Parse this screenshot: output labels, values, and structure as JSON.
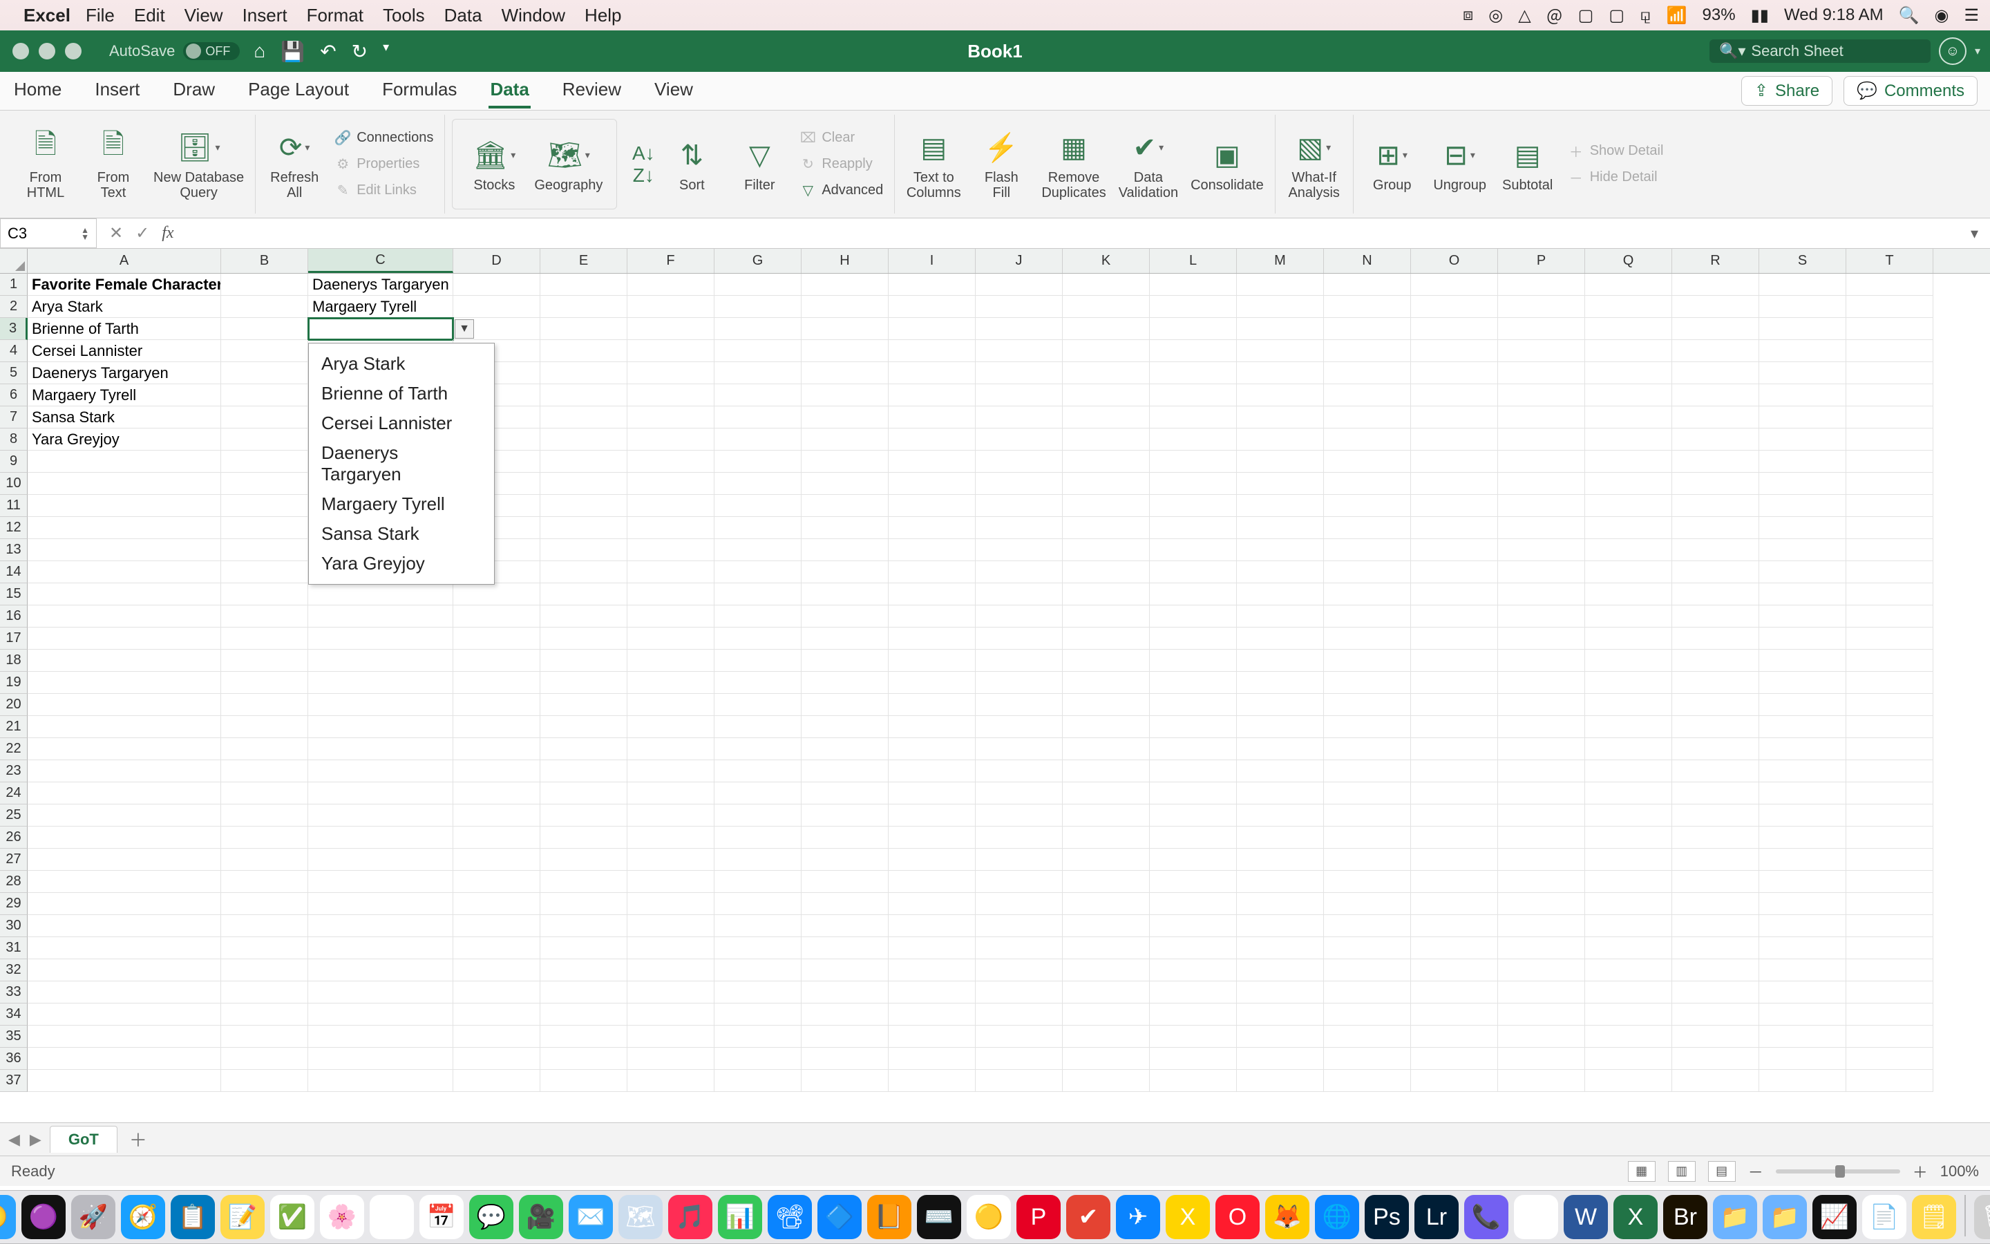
{
  "mac_menu": {
    "app_name": "Excel",
    "items": [
      "File",
      "Edit",
      "View",
      "Insert",
      "Format",
      "Tools",
      "Data",
      "Window",
      "Help"
    ],
    "battery_pct": "93%",
    "clock": "Wed 9:18 AM"
  },
  "titlebar": {
    "autosave_label": "AutoSave",
    "autosave_state": "OFF",
    "document_title": "Book1",
    "search_placeholder": "Search Sheet"
  },
  "ribbon_tabs": [
    "Home",
    "Insert",
    "Draw",
    "Page Layout",
    "Formulas",
    "Data",
    "Review",
    "View"
  ],
  "ribbon_active_tab": "Data",
  "ribbon_right": {
    "share": "Share",
    "comments": "Comments"
  },
  "ribbon": {
    "from_html": "From\nHTML",
    "from_text": "From\nText",
    "new_db_query": "New Database\nQuery",
    "refresh_all": "Refresh\nAll",
    "connections": "Connections",
    "properties": "Properties",
    "edit_links": "Edit Links",
    "stocks": "Stocks",
    "geography": "Geography",
    "sort": "Sort",
    "filter": "Filter",
    "clear": "Clear",
    "reapply": "Reapply",
    "advanced": "Advanced",
    "text_to_columns": "Text to\nColumns",
    "flash_fill": "Flash\nFill",
    "remove_dupes": "Remove\nDuplicates",
    "data_validation": "Data\nValidation",
    "consolidate": "Consolidate",
    "what_if": "What-If\nAnalysis",
    "group": "Group",
    "ungroup": "Ungroup",
    "subtotal": "Subtotal",
    "show_detail": "Show Detail",
    "hide_detail": "Hide Detail"
  },
  "fx": {
    "cell_ref": "C3",
    "formula": ""
  },
  "columns": [
    "A",
    "B",
    "C",
    "D",
    "E",
    "F",
    "G",
    "H",
    "I",
    "J",
    "K",
    "L",
    "M",
    "N",
    "O",
    "P",
    "Q",
    "R",
    "S",
    "T"
  ],
  "col_widths": [
    "wA",
    "wB",
    "wC",
    "wD",
    "wE",
    "wF",
    "wG",
    "wH",
    "wI",
    "wJ",
    "wK",
    "wL",
    "wM",
    "wN",
    "wO",
    "wP",
    "wQ",
    "wR",
    "wS",
    "wT"
  ],
  "active_col_index": 2,
  "active_row_index": 2,
  "num_rows": 37,
  "cells": {
    "A1": "Favorite Female Characters",
    "A2": "Arya Stark",
    "A3": "Brienne of Tarth",
    "A4": "Cersei Lannister",
    "A5": "Daenerys Targaryen",
    "A6": "Margaery Tyrell",
    "A7": "Sansa Stark",
    "A8": "Yara Greyjoy",
    "C1": "Daenerys Targaryen",
    "C2": "Margaery Tyrell",
    "C3": ""
  },
  "dropdown": {
    "items": [
      "Arya Stark",
      "Brienne of Tarth",
      "Cersei Lannister",
      "Daenerys Targaryen",
      "Margaery Tyrell",
      "Sansa Stark",
      "Yara Greyjoy"
    ]
  },
  "sheet": {
    "name": "GoT"
  },
  "status": {
    "ready": "Ready",
    "zoom": "100%"
  },
  "dock_apps": [
    {
      "n": "finder",
      "c": "#2aa3ff",
      "g": "🙂"
    },
    {
      "n": "siri",
      "c": "#111",
      "g": "🟣"
    },
    {
      "n": "launchpad",
      "c": "#b9b9bf",
      "g": "🚀"
    },
    {
      "n": "safari",
      "c": "#18a0ff",
      "g": "🧭"
    },
    {
      "n": "trello",
      "c": "#0079bf",
      "g": "📋"
    },
    {
      "n": "notes",
      "c": "#ffd94a",
      "g": "📝"
    },
    {
      "n": "reminders",
      "c": "#fff",
      "g": "✅"
    },
    {
      "n": "photos",
      "c": "#fff",
      "g": "🌸"
    },
    {
      "n": "preview",
      "c": "#fff",
      "g": "🖼"
    },
    {
      "n": "calendar",
      "c": "#fff",
      "g": "📅"
    },
    {
      "n": "messages",
      "c": "#34c759",
      "g": "💬"
    },
    {
      "n": "facetime",
      "c": "#34c759",
      "g": "🎥"
    },
    {
      "n": "mail",
      "c": "#2aa3ff",
      "g": "✉️"
    },
    {
      "n": "maps",
      "c": "#cde",
      "g": "🗺"
    },
    {
      "n": "itunes",
      "c": "#ff2d55",
      "g": "🎵"
    },
    {
      "n": "numbers-app",
      "c": "#34c759",
      "g": "📊"
    },
    {
      "n": "keynote",
      "c": "#0a84ff",
      "g": "📽"
    },
    {
      "n": "appstore",
      "c": "#0a84ff",
      "g": "🔷"
    },
    {
      "n": "books",
      "c": "#ff9500",
      "g": "📙"
    },
    {
      "n": "terminal",
      "c": "#111",
      "g": "⌨️"
    },
    {
      "n": "chrome",
      "c": "#fff",
      "g": "🟡"
    },
    {
      "n": "pinterest",
      "c": "#e60023",
      "g": "P"
    },
    {
      "n": "todoist",
      "c": "#e44332",
      "g": "✔︎"
    },
    {
      "n": "spark",
      "c": "#0a84ff",
      "g": "✈︎"
    },
    {
      "n": "mxapp",
      "c": "#ffd400",
      "g": "X"
    },
    {
      "n": "opera",
      "c": "#ff1b2d",
      "g": "O"
    },
    {
      "n": "firefox",
      "c": "#ffcc00",
      "g": "🦊"
    },
    {
      "n": "edge",
      "c": "#0a84ff",
      "g": "🌐"
    },
    {
      "n": "photoshop",
      "c": "#001e36",
      "g": "Ps"
    },
    {
      "n": "lightroom",
      "c": "#001e36",
      "g": "Lr"
    },
    {
      "n": "viber",
      "c": "#7360f2",
      "g": "📞"
    },
    {
      "n": "slack",
      "c": "#fff",
      "g": "⌗"
    },
    {
      "n": "word",
      "c": "#2b579a",
      "g": "W"
    },
    {
      "n": "excel",
      "c": "#217346",
      "g": "X"
    },
    {
      "n": "bridge",
      "c": "#1a1100",
      "g": "Br"
    },
    {
      "n": "folder",
      "c": "#6cb3ff",
      "g": "📁"
    },
    {
      "n": "folder2",
      "c": "#6cb3ff",
      "g": "📁"
    },
    {
      "n": "activity",
      "c": "#111",
      "g": "📈"
    },
    {
      "n": "textedit",
      "c": "#fff",
      "g": "📄"
    },
    {
      "n": "stickies",
      "c": "#ffd94a",
      "g": "🗒"
    },
    {
      "n": "trash",
      "c": "#d0d0d0",
      "g": "🗑"
    }
  ]
}
